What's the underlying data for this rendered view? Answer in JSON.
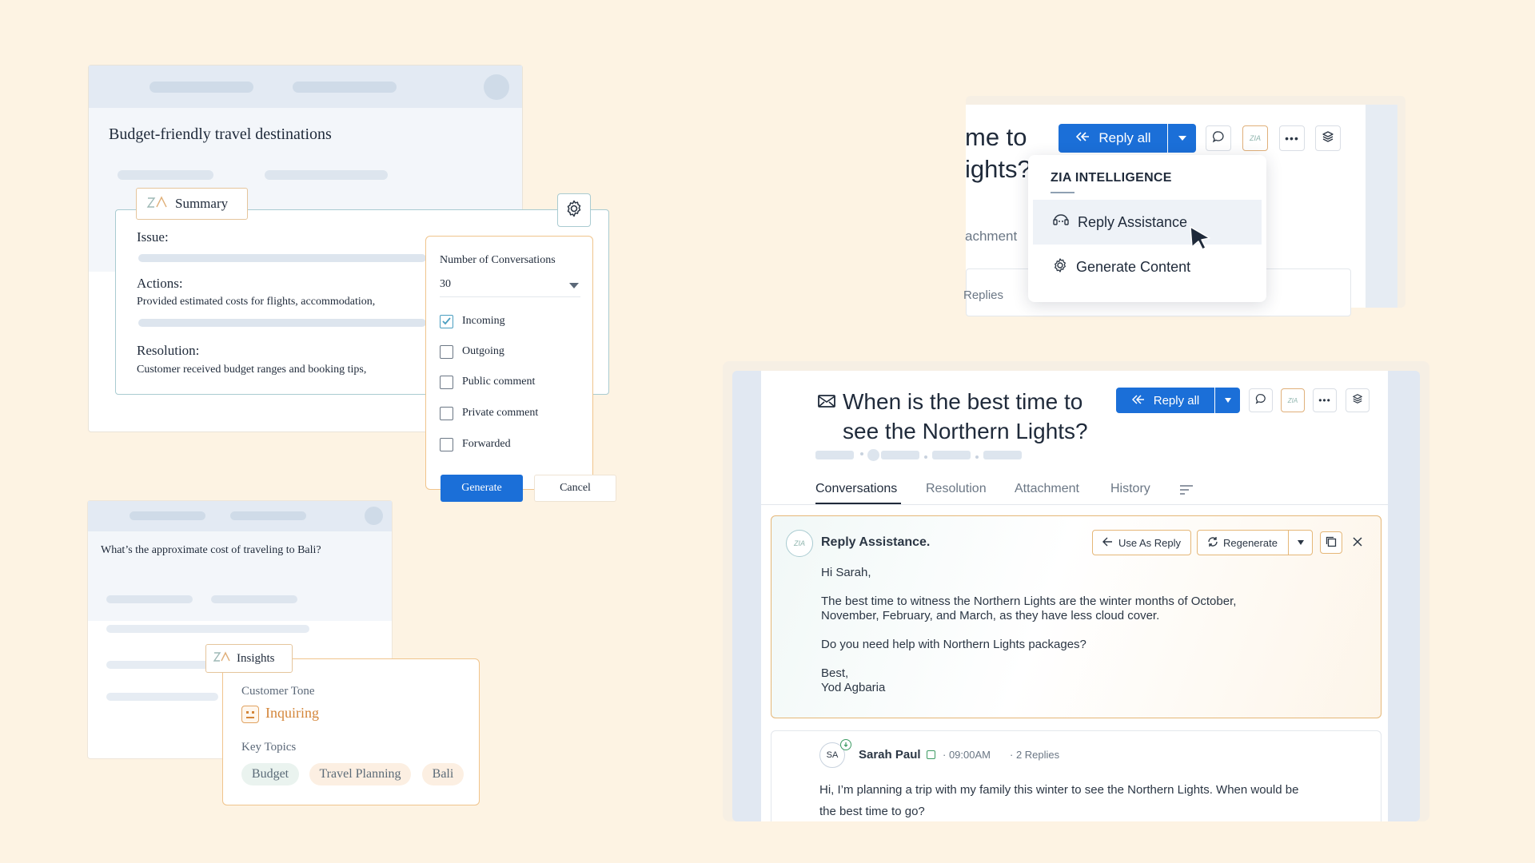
{
  "summary_card": {
    "title": "Budget-friendly travel destinations",
    "tag_label": "Summary",
    "issue_label": "Issue:",
    "actions_label": "Actions:",
    "actions_text": "Provided estimated costs for flights, accommodation,",
    "resolution_label": "Resolution:",
    "resolution_text": "Customer received budget ranges and booking tips,"
  },
  "settings_popup": {
    "heading": "Number of Conversations",
    "select_value": "30",
    "options": [
      {
        "label": "Incoming",
        "checked": true
      },
      {
        "label": "Outgoing",
        "checked": false
      },
      {
        "label": "Public comment",
        "checked": false
      },
      {
        "label": "Private comment",
        "checked": false
      },
      {
        "label": "Forwarded",
        "checked": false
      }
    ],
    "generate_label": "Generate",
    "cancel_label": "Cancel"
  },
  "insights_card": {
    "question": "What’s the approximate cost of traveling to Bali?",
    "tag_label": "Insights",
    "tone_label": "Customer Tone",
    "tone_value": "Inquiring",
    "topics_label": "Key Topics",
    "topics": [
      "Budget",
      "Travel Planning",
      "Bali"
    ]
  },
  "top_right": {
    "title_line1": "me to",
    "title_line2": "ights?",
    "tab_partial": "achment",
    "replies_partial": "Replies",
    "reply_all_label": "Reply all",
    "zia_badge": "ZIA",
    "menu": {
      "heading": "ZIA INTELLIGENCE",
      "items": [
        "Reply Assistance",
        "Generate Content"
      ]
    }
  },
  "ticket": {
    "title_line1": "When is the best time to",
    "title_line2": "see the Northern Lights?",
    "reply_all_label": "Reply all",
    "zia_badge": "ZIA",
    "tabs": [
      "Conversations",
      "Resolution",
      "Attachment",
      "History"
    ],
    "reply_assist": {
      "zia_badge": "ZIA",
      "title": "Reply Assistance.",
      "use_as_reply": "Use As Reply",
      "regenerate": "Regenerate",
      "greeting": "Hi Sarah,",
      "para1_line1": "The best time to witness the Northern Lights are the winter months of October,",
      "para1_line2": "November, February, and March, as they have less cloud cover.",
      "para2": "Do you need help with Northern Lights packages?",
      "signoff": "Best,",
      "signature": "Yod Agbaria"
    },
    "message": {
      "initials": "SA",
      "author": "Sarah Paul",
      "time": "09:00AM",
      "replies": "2 Replies",
      "body_line1": "Hi, I’m planning a trip with my family this winter to see the Northern Lights. When would be",
      "body_line2": "the best time to go?"
    }
  },
  "colors": {
    "background": "#fdf3e3",
    "primary_blue": "#1b6fd8",
    "zia_border": "#e5b778",
    "teal_border": "#a9cbd1",
    "tone_orange": "#d4863a"
  }
}
